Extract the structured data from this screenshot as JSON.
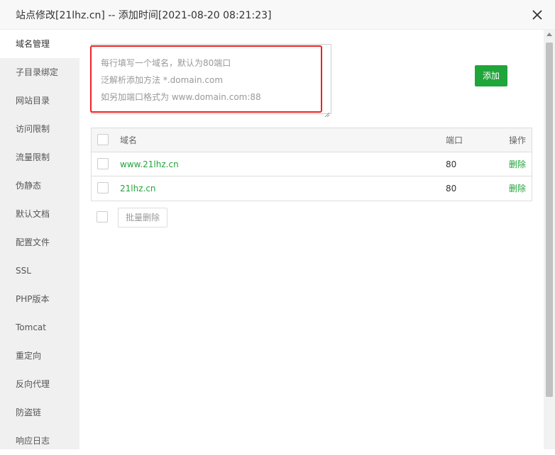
{
  "dialog": {
    "title": "站点修改[21lhz.cn] -- 添加时间[2021-08-20 08:21:23]"
  },
  "sidebar": {
    "items": [
      {
        "label": "域名管理",
        "active": true
      },
      {
        "label": "子目录绑定"
      },
      {
        "label": "网站目录"
      },
      {
        "label": "访问限制"
      },
      {
        "label": "流量限制"
      },
      {
        "label": "伪静态"
      },
      {
        "label": "默认文档"
      },
      {
        "label": "配置文件"
      },
      {
        "label": "SSL"
      },
      {
        "label": "PHP版本"
      },
      {
        "label": "Tomcat"
      },
      {
        "label": "重定向"
      },
      {
        "label": "反向代理"
      },
      {
        "label": "防盗链"
      },
      {
        "label": "响应日志"
      }
    ]
  },
  "domain_input": {
    "value": "",
    "placeholder_lines": [
      "每行填写一个域名，默认为80端口",
      "泛解析添加方法 *.domain.com",
      "如另加端口格式为 www.domain.com:88"
    ]
  },
  "add_button": {
    "label": "添加"
  },
  "table": {
    "headers": {
      "name": "域名",
      "port": "端口",
      "action": "操作"
    },
    "rows": [
      {
        "name": "www.21lhz.cn",
        "port": "80",
        "action": "删除"
      },
      {
        "name": "21lhz.cn",
        "port": "80",
        "action": "删除"
      }
    ]
  },
  "batch": {
    "delete_label": "批量删除"
  },
  "colors": {
    "accent": "#20a53a",
    "highlight": "#e22222"
  }
}
